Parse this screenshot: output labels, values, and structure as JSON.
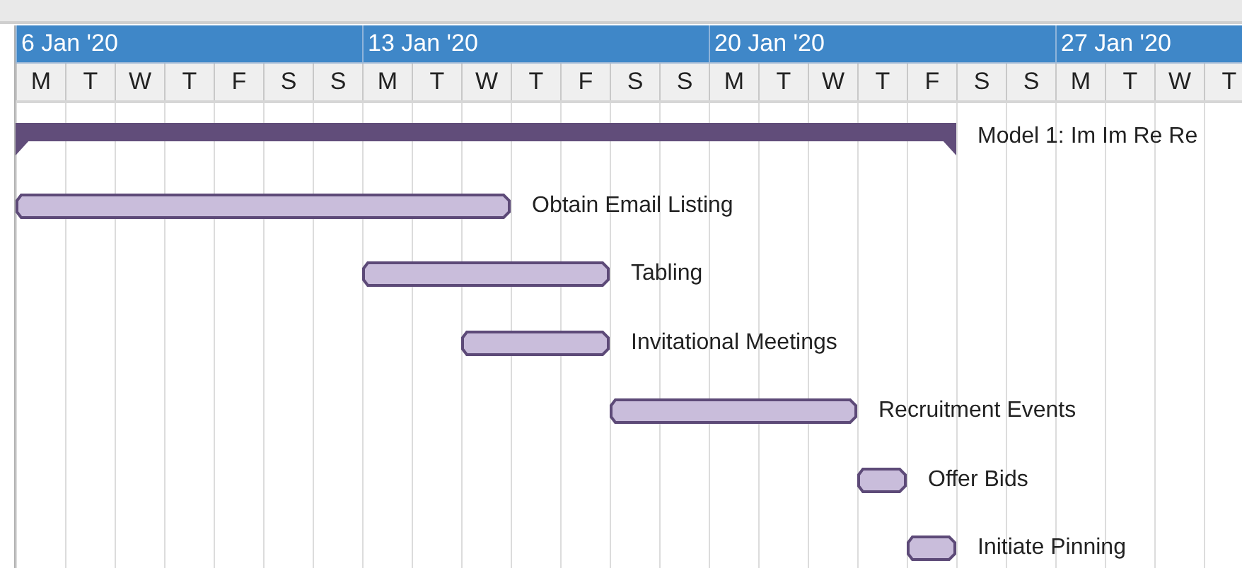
{
  "timeline": {
    "weeks": [
      {
        "label": "6 Jan '20",
        "days": [
          "M",
          "T",
          "W",
          "T",
          "F",
          "S",
          "S"
        ]
      },
      {
        "label": "13 Jan '20",
        "days": [
          "M",
          "T",
          "W",
          "T",
          "F",
          "S",
          "S"
        ]
      },
      {
        "label": "20 Jan '20",
        "days": [
          "M",
          "T",
          "W",
          "T",
          "F",
          "S",
          "S"
        ]
      },
      {
        "label": "27 Jan '20",
        "days": [
          "M",
          "T",
          "W",
          "T"
        ]
      }
    ]
  },
  "tasks": [
    {
      "kind": "summary",
      "name": "Model 1: Im Im Re Re",
      "days": [
        true,
        true,
        true,
        true,
        true,
        true,
        true,
        true,
        true,
        true,
        true,
        true,
        true,
        true,
        true,
        true,
        true,
        true,
        true,
        false,
        false,
        false,
        false,
        false,
        false
      ]
    },
    {
      "kind": "task",
      "name": "Obtain Email Listing",
      "days": [
        true,
        true,
        true,
        true,
        true,
        true,
        true,
        true,
        true,
        true,
        false,
        false,
        false,
        false,
        false,
        false,
        false,
        false,
        false,
        false,
        false,
        false,
        false,
        false,
        false
      ]
    },
    {
      "kind": "task",
      "name": "Tabling",
      "days": [
        false,
        false,
        false,
        false,
        false,
        false,
        false,
        true,
        true,
        true,
        true,
        true,
        false,
        false,
        false,
        false,
        false,
        false,
        false,
        false,
        false,
        false,
        false,
        false,
        false
      ]
    },
    {
      "kind": "task",
      "name": "Invitational Meetings",
      "days": [
        false,
        false,
        false,
        false,
        false,
        false,
        false,
        false,
        false,
        true,
        true,
        true,
        false,
        false,
        false,
        false,
        false,
        false,
        false,
        false,
        false,
        false,
        false,
        false,
        false
      ]
    },
    {
      "kind": "task",
      "name": "Recruitment Events",
      "days": [
        false,
        false,
        false,
        false,
        false,
        false,
        false,
        false,
        false,
        false,
        false,
        false,
        true,
        true,
        true,
        true,
        true,
        false,
        false,
        false,
        false,
        false,
        false,
        false,
        false
      ]
    },
    {
      "kind": "task",
      "name": "Offer Bids",
      "days": [
        false,
        false,
        false,
        false,
        false,
        false,
        false,
        false,
        false,
        false,
        false,
        false,
        false,
        false,
        false,
        false,
        false,
        true,
        false,
        false,
        false,
        false,
        false,
        false,
        false
      ]
    },
    {
      "kind": "task",
      "name": "Initiate Pinning",
      "days": [
        false,
        false,
        false,
        false,
        false,
        false,
        false,
        false,
        false,
        false,
        false,
        false,
        false,
        false,
        false,
        false,
        false,
        false,
        true,
        false,
        false,
        false,
        false,
        false,
        false
      ]
    }
  ]
}
